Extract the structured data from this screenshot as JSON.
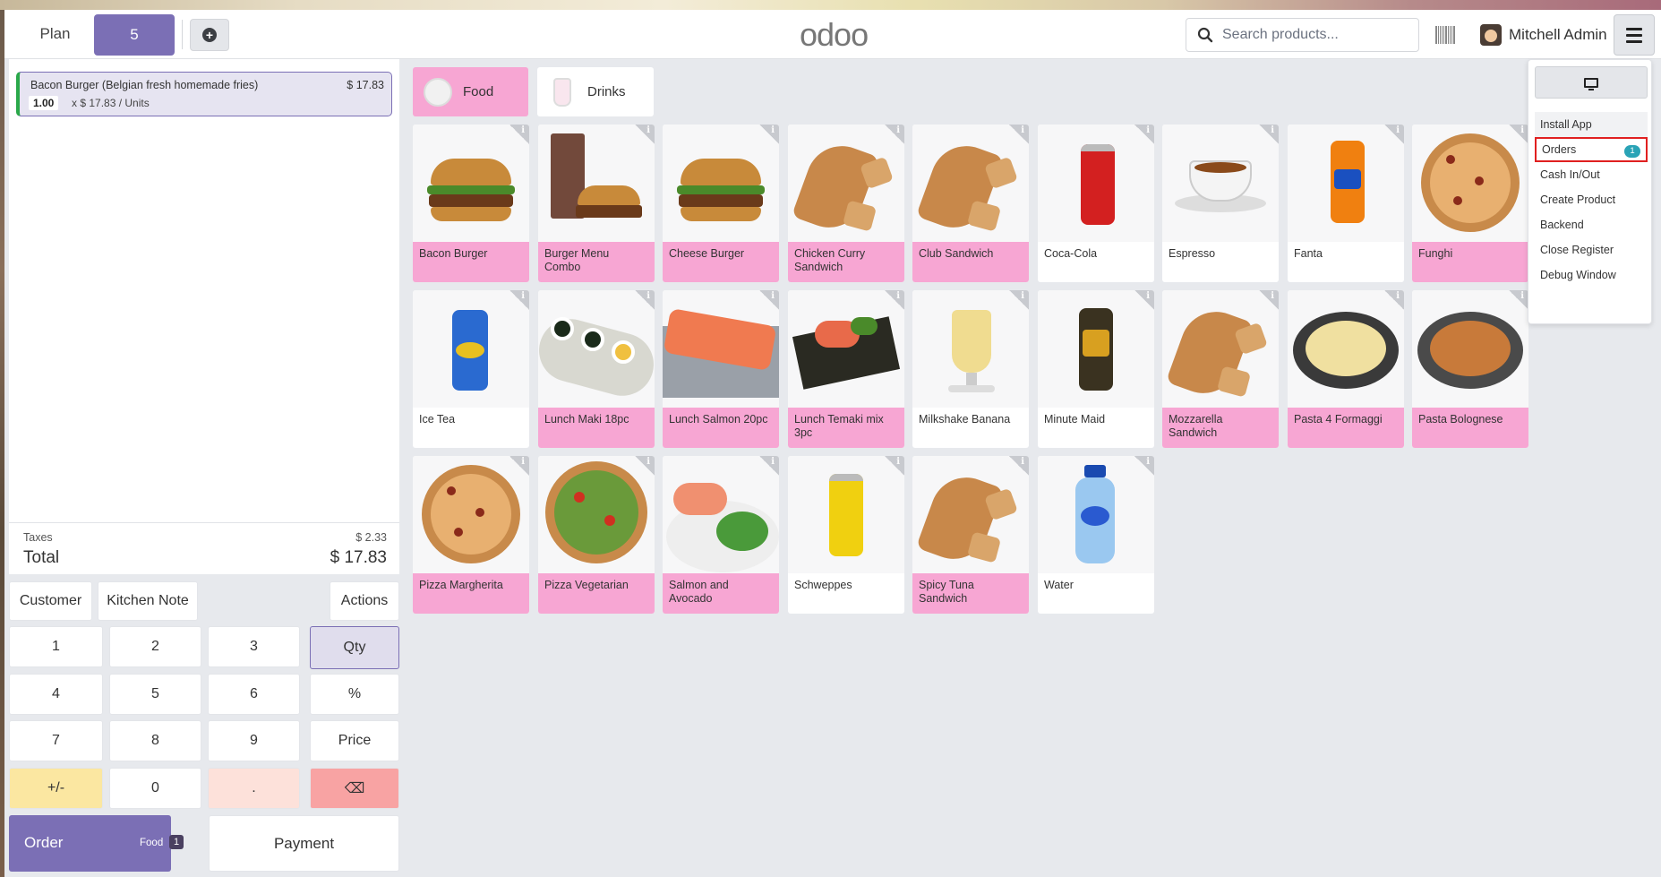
{
  "header": {
    "plan_label": "Plan",
    "table_label": "5",
    "logo": "odoo",
    "search_placeholder": "Search products...",
    "user_name": "Mitchell Admin"
  },
  "order": {
    "line": {
      "name": "Bacon Burger (Belgian fresh homemade fries)",
      "price": "$ 17.83",
      "qty": "1.00",
      "unit_text": "x $ 17.83 / Units"
    },
    "taxes_label": "Taxes",
    "taxes_value": "$ 2.33",
    "total_label": "Total",
    "total_value": "$ 17.83"
  },
  "controls": {
    "customer": "Customer",
    "kitchen_note": "Kitchen Note",
    "actions": "Actions",
    "keys": [
      "1",
      "2",
      "3",
      "4",
      "5",
      "6",
      "7",
      "8",
      "9",
      "+/-",
      "0",
      "."
    ],
    "qty": "Qty",
    "percent": "%",
    "price": "Price",
    "backspace": "⌫",
    "order_label": "Order",
    "order_sub": "Food",
    "order_count": "1",
    "payment": "Payment"
  },
  "categories": [
    {
      "label": "Food",
      "active": true
    },
    {
      "label": "Drinks",
      "active": false
    }
  ],
  "products": [
    {
      "name": "Bacon Burger",
      "pink": true,
      "icon": "burger"
    },
    {
      "name": "Burger Menu Combo",
      "pink": true,
      "icon": "combo"
    },
    {
      "name": "Cheese Burger",
      "pink": true,
      "icon": "burger"
    },
    {
      "name": "Chicken Curry Sandwich",
      "pink": true,
      "icon": "sandwich"
    },
    {
      "name": "Club Sandwich",
      "pink": true,
      "icon": "sandwich"
    },
    {
      "name": "Coca-Cola",
      "pink": false,
      "icon": "can-red"
    },
    {
      "name": "Espresso",
      "pink": false,
      "icon": "cup"
    },
    {
      "name": "Fanta",
      "pink": false,
      "icon": "can-orange"
    },
    {
      "name": "Funghi",
      "pink": true,
      "icon": "pizza"
    },
    {
      "name": "Ice Tea",
      "pink": false,
      "icon": "can-blue"
    },
    {
      "name": "Lunch Maki 18pc",
      "pink": true,
      "icon": "sushi"
    },
    {
      "name": "Lunch Salmon 20pc",
      "pink": true,
      "icon": "salmon"
    },
    {
      "name": "Lunch Temaki mix 3pc",
      "pink": true,
      "icon": "temaki"
    },
    {
      "name": "Milkshake Banana",
      "pink": false,
      "icon": "milkshake"
    },
    {
      "name": "Minute Maid",
      "pink": false,
      "icon": "can-dark"
    },
    {
      "name": "Mozzarella Sandwich",
      "pink": true,
      "icon": "sandwich"
    },
    {
      "name": "Pasta 4 Formaggi",
      "pink": true,
      "icon": "pasta"
    },
    {
      "name": "Pasta Bolognese",
      "pink": true,
      "icon": "pasta-red"
    },
    {
      "name": "Pizza Margherita",
      "pink": true,
      "icon": "pizza"
    },
    {
      "name": "Pizza Vegetarian",
      "pink": true,
      "icon": "pizza-green"
    },
    {
      "name": "Salmon and Avocado",
      "pink": true,
      "icon": "salad"
    },
    {
      "name": "Schweppes",
      "pink": false,
      "icon": "can-yellow"
    },
    {
      "name": "Spicy Tuna Sandwich",
      "pink": true,
      "icon": "sandwich"
    },
    {
      "name": "Water",
      "pink": false,
      "icon": "bottle"
    }
  ],
  "menu": {
    "items": [
      "Install App",
      "Orders",
      "Cash In/Out",
      "Create Product",
      "Backend",
      "Close Register",
      "Debug Window"
    ],
    "orders_badge": "1"
  },
  "colors": {
    "primary": "#7b6fb5",
    "pink": "#f7a6d3",
    "badge": "#2aa3b6",
    "highlight": "#e02020"
  }
}
